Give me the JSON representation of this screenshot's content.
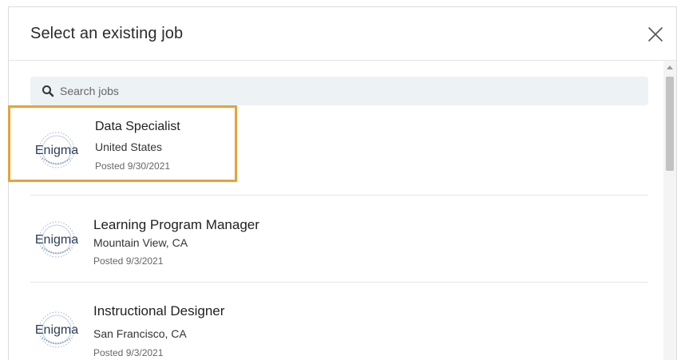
{
  "dialog": {
    "title": "Select an existing job"
  },
  "search": {
    "placeholder": "Search jobs",
    "value": ""
  },
  "jobs": [
    {
      "company_logo_text": "Enigma",
      "title": "Data Specialist",
      "location": "United States",
      "posted": "Posted 9/30/2021",
      "selected": true
    },
    {
      "company_logo_text": "Enigma",
      "title": "Learning Program Manager",
      "location": "Mountain View, CA",
      "posted": "Posted 9/3/2021",
      "selected": false
    },
    {
      "company_logo_text": "Enigma",
      "title": "Instructional Designer",
      "location": "San Francisco, CA",
      "posted": "Posted 9/3/2021",
      "selected": false
    }
  ],
  "colors": {
    "highlight": "#e5a33b",
    "search_bg": "#edf2f5"
  },
  "icons": {
    "close": "close-icon",
    "search": "search-icon"
  }
}
